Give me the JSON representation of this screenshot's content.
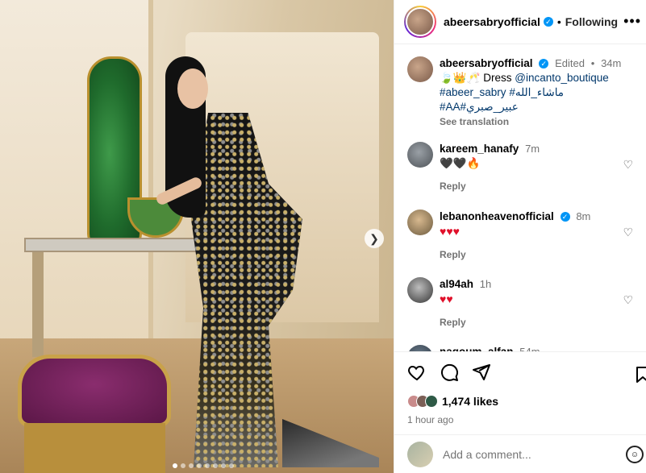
{
  "post": {
    "username": "abeersabryofficial",
    "follow_status": "Following",
    "more_label": "•••"
  },
  "caption": {
    "username": "abeersabryofficial",
    "edited": "Edited",
    "time": "34m",
    "emojis": "🍃👑🥂",
    "text_prefix": "Dress",
    "mention": "@incanto_boutique",
    "tag1": "#abeer_sabry",
    "tag2": "#ماشاء_الله",
    "tag3": "#AA",
    "tag4": "#عبير_صبري",
    "see_translation": "See translation"
  },
  "comments": [
    {
      "username": "kareem_hanafy",
      "time": "7m",
      "text": "🖤🖤🔥",
      "reply": "Reply",
      "verified": false
    },
    {
      "username": "lebanonheavenofficial",
      "time": "8m",
      "text": "♥♥♥",
      "reply": "Reply",
      "verified": true
    },
    {
      "username": "al94ah",
      "time": "1h",
      "text": "♥♥",
      "reply": "Reply",
      "verified": false
    },
    {
      "username": "nagoum_alfan",
      "time": "54m"
    }
  ],
  "actions": {
    "likes": "1,474 likes",
    "posted": "1 hour ago",
    "add_comment_placeholder": "Add a comment..."
  },
  "colors": {
    "link": "#00376b",
    "verified": "#0095f6",
    "heart_red": "#e0102a",
    "muted": "#737373"
  }
}
